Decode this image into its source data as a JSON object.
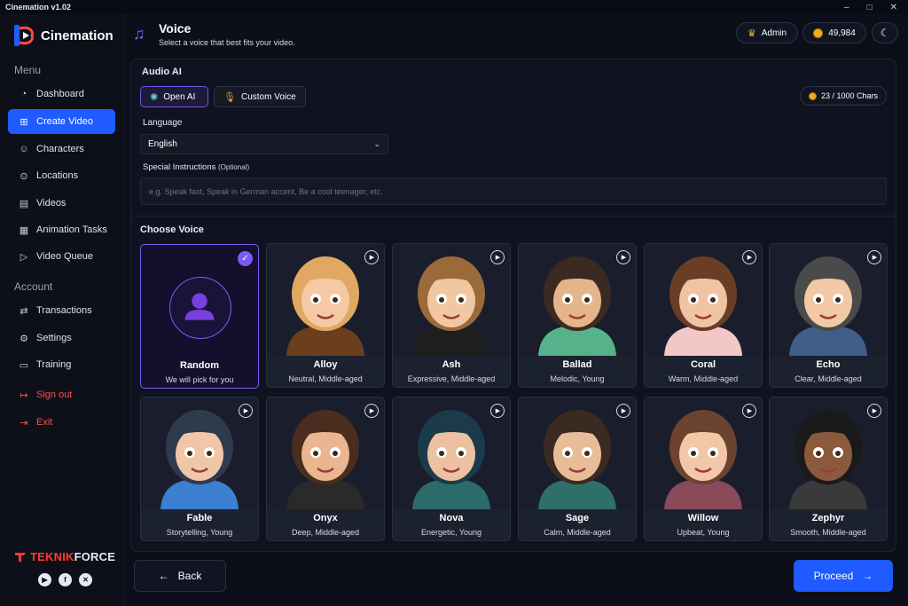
{
  "window": {
    "title": "Cinemation v1.02",
    "controls": [
      "–",
      "□",
      "✕"
    ]
  },
  "brand": {
    "name": "Cinemation"
  },
  "sidebar": {
    "menu_title": "Menu",
    "items": [
      {
        "label": "Dashboard",
        "icon": "gauge-icon"
      },
      {
        "label": "Create Video",
        "icon": "video-add-icon",
        "active": true
      },
      {
        "label": "Characters",
        "icon": "characters-icon"
      },
      {
        "label": "Locations",
        "icon": "location-pin-icon"
      },
      {
        "label": "Videos",
        "icon": "film-icon"
      },
      {
        "label": "Animation Tasks",
        "icon": "tasks-icon"
      },
      {
        "label": "Video Queue",
        "icon": "queue-icon"
      }
    ],
    "account_title": "Account",
    "account_items": [
      {
        "label": "Transactions",
        "icon": "transactions-icon"
      },
      {
        "label": "Settings",
        "icon": "gear-icon"
      },
      {
        "label": "Training",
        "icon": "training-icon"
      }
    ],
    "danger_items": [
      {
        "label": "Sign out",
        "icon": "sign-out-icon"
      },
      {
        "label": "Exit",
        "icon": "exit-icon"
      }
    ],
    "footer_brand": {
      "part1": "TEKNIK",
      "part2": "FORCE"
    },
    "socials": [
      "youtube-icon",
      "facebook-icon",
      "x-icon"
    ]
  },
  "header": {
    "title": "Voice",
    "subtitle": "Select a voice that best fits your video.",
    "user": "Admin",
    "credits": "49,984",
    "theme_icon": "moon-icon"
  },
  "audio": {
    "section_title": "Audio AI",
    "provider_buttons": [
      {
        "label": "Open AI",
        "active": true
      },
      {
        "label": "Custom Voice",
        "active": false
      }
    ],
    "chars_counter": "23 / 1000 Chars",
    "language_label": "Language",
    "language_value": "English",
    "instructions_label": "Special Instructions",
    "instructions_optional": "(Optional)",
    "instructions_placeholder": "e.g. Speak fast, Speak in German accent, Be a cool teenager, etc."
  },
  "voices": {
    "section_title": "Choose Voice",
    "selected": "Random",
    "items": [
      {
        "name": "Random",
        "desc": "We will pick for you"
      },
      {
        "name": "Alloy",
        "desc": "Neutral, Middle-aged"
      },
      {
        "name": "Ash",
        "desc": "Expressive, Middle-aged"
      },
      {
        "name": "Ballad",
        "desc": "Melodic, Young"
      },
      {
        "name": "Coral",
        "desc": "Warm, Middle-aged"
      },
      {
        "name": "Echo",
        "desc": "Clear, Middle-aged"
      },
      {
        "name": "Fable",
        "desc": "Storytelling, Young"
      },
      {
        "name": "Onyx",
        "desc": "Deep, Middle-aged"
      },
      {
        "name": "Nova",
        "desc": "Energetic, Young"
      },
      {
        "name": "Sage",
        "desc": "Calm, Middle-aged"
      },
      {
        "name": "Willow",
        "desc": "Upbeat, Young"
      },
      {
        "name": "Zephyr",
        "desc": "Smooth, Middle-aged"
      }
    ]
  },
  "footer": {
    "back_label": "Back",
    "proceed_label": "Proceed"
  },
  "colors": {
    "accent": "#1f5bff",
    "select": "#7a5bf5",
    "danger": "#ff4a4a",
    "coin": "#f5a623"
  }
}
